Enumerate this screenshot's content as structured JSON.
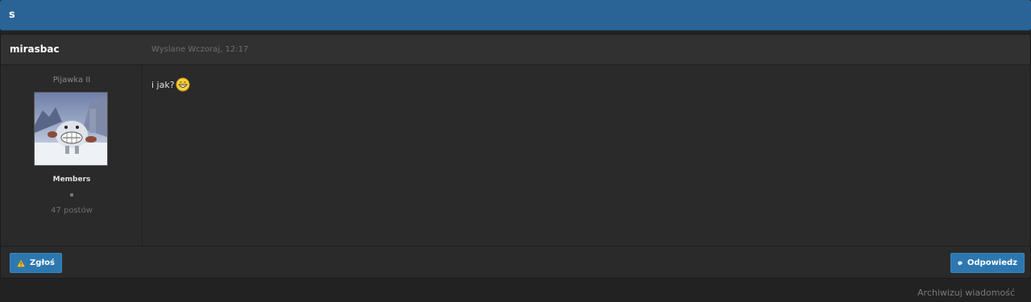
{
  "topic": {
    "title": "s"
  },
  "post": {
    "author": "mirasbac",
    "date": "Wyslane Wczoraj, 12:17",
    "rank_title": "Pijawka II",
    "group": "Members",
    "post_count": "47 postów",
    "body_text": "i jak?",
    "emoticon": "grinning-face-icon"
  },
  "footer": {
    "report_label": "Zgłoś",
    "report_icon": "warning-icon",
    "reply_label": "Odpowiedz",
    "reply_icon": "speech-bubble-icon"
  },
  "archive_link": "Archiwizuj wiadomość",
  "colors": {
    "topic_bar": "#2a6496",
    "button": "#2d77b0",
    "background": "#222222"
  }
}
